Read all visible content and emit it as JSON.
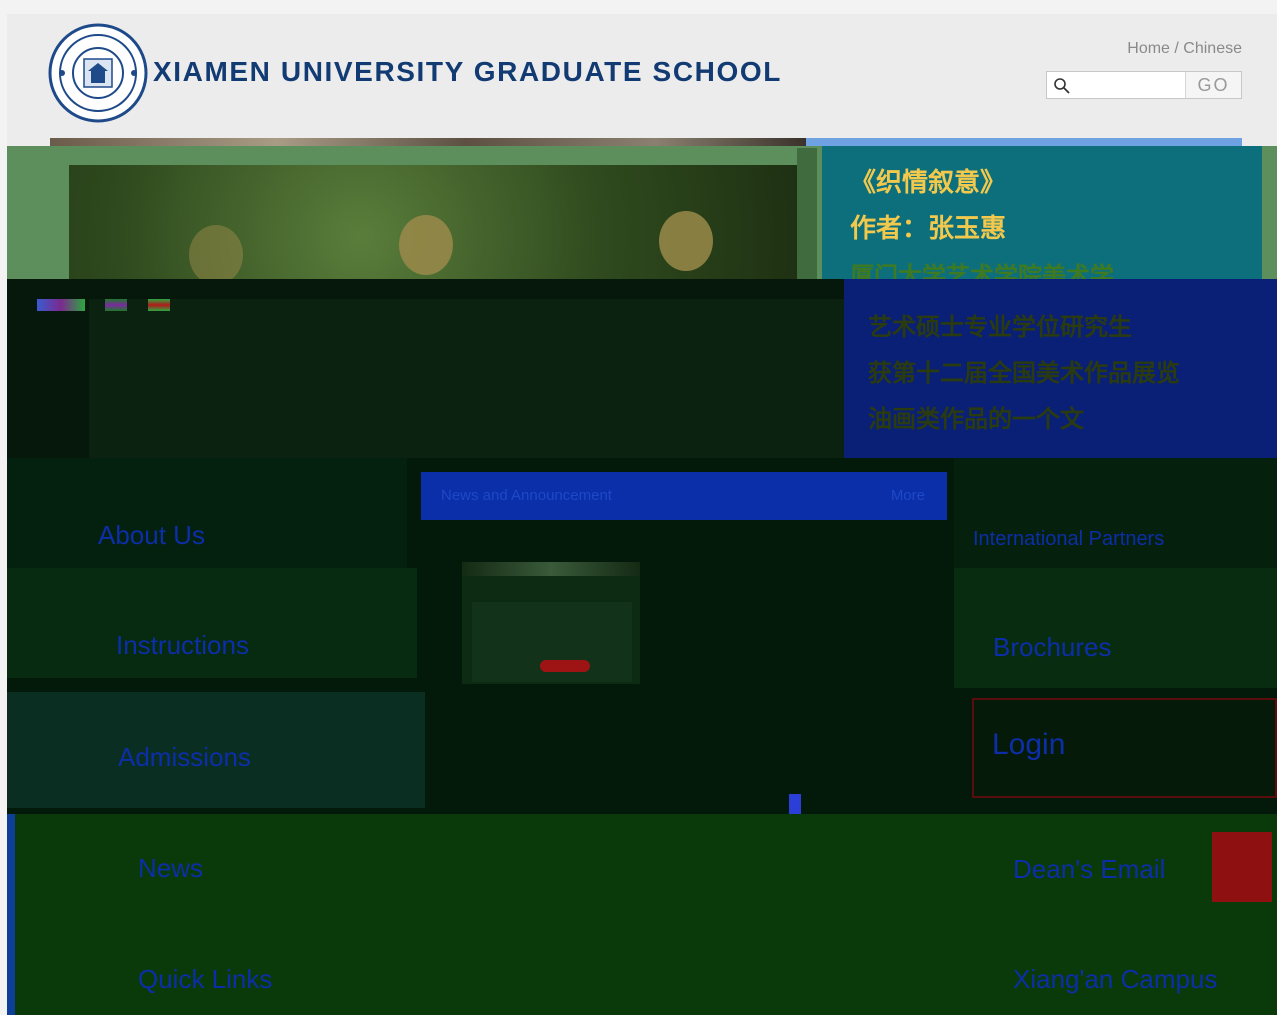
{
  "header": {
    "title": "XIAMEN UNIVERSITY GRADUATE SCHOOL",
    "links": {
      "home": "Home",
      "separator": " / ",
      "chinese": "Chinese"
    },
    "search": {
      "placeholder": "",
      "button": "GO"
    }
  },
  "banner": {
    "caption": [
      "《织情叙意》",
      "作者：张玉惠",
      "厦门大学艺术学院美术学",
      "艺术硕士专业学位研究生",
      "获第十二届全国美术作品展览",
      "油画类作品的一个文"
    ],
    "slide_count": 3
  },
  "news": {
    "label": "News and Announcement",
    "more": "More"
  },
  "tiles": {
    "left": [
      "About Us",
      "Instructions",
      "Admissions",
      "News",
      "Quick Links"
    ],
    "right": [
      "International Partners",
      "Brochures",
      "Login",
      "Dean's Email",
      "Xiang'an Campus"
    ]
  },
  "colors": {
    "title": "#123a73",
    "caption_bg": "#0e6f7c",
    "caption_text": "#f2c94c",
    "tile_text": "#0c2ea8"
  }
}
